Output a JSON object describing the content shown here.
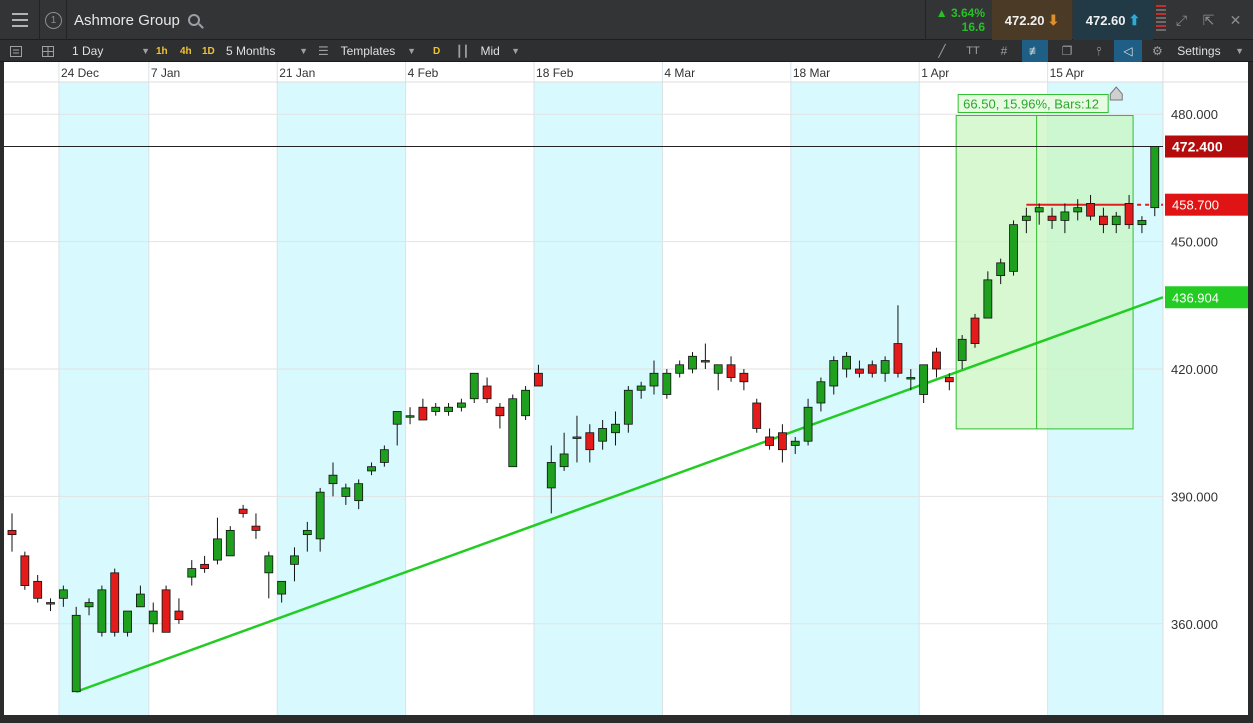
{
  "header": {
    "instrument": "Ashmore Group",
    "version_number": "1",
    "change_pct": "3.64%",
    "change_pts": "16.6",
    "sell_price": "472.20",
    "buy_price": "472.60"
  },
  "toolbar": {
    "timeframe": "1 Day",
    "tf_buttons": [
      "1h",
      "4h",
      "1D"
    ],
    "period": "5 Months",
    "templates": "Templates",
    "d_button": "D",
    "price_type": "Mid",
    "settings": "Settings"
  },
  "colors": {
    "up_candle": "#1ea01e",
    "down_candle": "#e31b1b",
    "trendline": "#22cc22",
    "weekend_band": "#d8fafe",
    "measure_fill": "#c9f5c2",
    "current_price_tag": "#b40c0c",
    "level_tag": "#e01414",
    "trend_tag": "#22cc22"
  },
  "chart_data": {
    "type": "candlestick",
    "title": "",
    "x_tick_labels": [
      "24 Dec",
      "7 Jan",
      "21 Jan",
      "4 Feb",
      "18 Feb",
      "4 Mar",
      "18 Mar",
      "1 Apr",
      "15 Apr"
    ],
    "y_tick_labels": [
      "480.000",
      "450.000",
      "420.000",
      "390.000",
      "360.000"
    ],
    "y_ticks": [
      480,
      450,
      420,
      390,
      360
    ],
    "ylim": [
      347,
      481
    ],
    "grid": true,
    "current_price": {
      "value": 472.4,
      "label": "472.400"
    },
    "horizontal_level": {
      "value": 458.7,
      "label": "458.700"
    },
    "trendline": {
      "label": "436.904",
      "start_value": 344.0,
      "end_value": 436.9
    },
    "measurement": {
      "label": "66.50, 15.96%, Bars:12",
      "from": 405.9,
      "to": 472.4
    },
    "candles": [
      {
        "date": "18 Dec",
        "open": 382.0,
        "high": 386.0,
        "low": 377.0,
        "close": 381.0
      },
      {
        "date": "19 Dec",
        "open": 376.0,
        "high": 377.0,
        "low": 368.0,
        "close": 369.0
      },
      {
        "date": "20 Dec",
        "open": 370.0,
        "high": 371.5,
        "low": 365.0,
        "close": 366.0
      },
      {
        "date": "21 Dec",
        "open": 365.0,
        "high": 366.0,
        "low": 363.0,
        "close": 365.0
      },
      {
        "date": "24 Dec",
        "open": 366.0,
        "high": 369.0,
        "low": 364.0,
        "close": 368.0
      },
      {
        "date": "27 Dec",
        "open": 344.0,
        "high": 364.0,
        "low": 344.0,
        "close": 362.0
      },
      {
        "date": "28 Dec",
        "open": 364.0,
        "high": 366.0,
        "low": 362.0,
        "close": 365.0
      },
      {
        "date": "31 Dec",
        "open": 358.0,
        "high": 369.0,
        "low": 357.0,
        "close": 368.0
      },
      {
        "date": "2 Jan",
        "open": 372.0,
        "high": 373.0,
        "low": 357.0,
        "close": 358.0
      },
      {
        "date": "3 Jan",
        "open": 358.0,
        "high": 363.0,
        "low": 357.0,
        "close": 363.0
      },
      {
        "date": "4 Jan",
        "open": 364.0,
        "high": 369.0,
        "low": 364.0,
        "close": 367.0
      },
      {
        "date": "7 Jan",
        "open": 360.0,
        "high": 365.0,
        "low": 358.0,
        "close": 363.0
      },
      {
        "date": "8 Jan",
        "open": 368.0,
        "high": 369.0,
        "low": 358.0,
        "close": 358.0
      },
      {
        "date": "9 Jan",
        "open": 363.0,
        "high": 366.0,
        "low": 360.0,
        "close": 361.0
      },
      {
        "date": "10 Jan",
        "open": 371.0,
        "high": 375.0,
        "low": 369.0,
        "close": 373.0
      },
      {
        "date": "11 Jan",
        "open": 374.0,
        "high": 376.0,
        "low": 372.0,
        "close": 373.0
      },
      {
        "date": "14 Jan",
        "open": 375.0,
        "high": 385.0,
        "low": 374.0,
        "close": 380.0
      },
      {
        "date": "15 Jan",
        "open": 376.0,
        "high": 383.0,
        "low": 376.0,
        "close": 382.0
      },
      {
        "date": "16 Jan",
        "open": 387.0,
        "high": 388.0,
        "low": 385.0,
        "close": 386.0
      },
      {
        "date": "17 Jan",
        "open": 383.0,
        "high": 386.0,
        "low": 380.0,
        "close": 382.0
      },
      {
        "date": "18 Jan",
        "open": 372.0,
        "high": 377.0,
        "low": 366.0,
        "close": 376.0
      },
      {
        "date": "21 Jan",
        "open": 367.0,
        "high": 370.0,
        "low": 365.0,
        "close": 370.0
      },
      {
        "date": "22 Jan",
        "open": 374.0,
        "high": 378.0,
        "low": 370.0,
        "close": 376.0
      },
      {
        "date": "23 Jan",
        "open": 381.0,
        "high": 384.0,
        "low": 377.0,
        "close": 382.0
      },
      {
        "date": "24 Jan",
        "open": 380.0,
        "high": 392.0,
        "low": 377.0,
        "close": 391.0
      },
      {
        "date": "25 Jan",
        "open": 393.0,
        "high": 398.0,
        "low": 390.0,
        "close": 395.0
      },
      {
        "date": "28 Jan",
        "open": 390.0,
        "high": 393.0,
        "low": 388.0,
        "close": 392.0
      },
      {
        "date": "29 Jan",
        "open": 389.0,
        "high": 394.0,
        "low": 387.0,
        "close": 393.0
      },
      {
        "date": "30 Jan",
        "open": 396.0,
        "high": 398.0,
        "low": 395.0,
        "close": 397.0
      },
      {
        "date": "31 Jan",
        "open": 398.0,
        "high": 402.0,
        "low": 397.0,
        "close": 401.0
      },
      {
        "date": "1 Feb",
        "open": 407.0,
        "high": 410.0,
        "low": 402.0,
        "close": 410.0
      },
      {
        "date": "4 Feb",
        "open": 409.0,
        "high": 411.0,
        "low": 407.0,
        "close": 409.0
      },
      {
        "date": "5 Feb",
        "open": 411.0,
        "high": 413.0,
        "low": 408.0,
        "close": 408.0
      },
      {
        "date": "6 Feb",
        "open": 410.0,
        "high": 412.0,
        "low": 409.0,
        "close": 411.0
      },
      {
        "date": "7 Feb",
        "open": 410.0,
        "high": 412.0,
        "low": 409.0,
        "close": 411.0
      },
      {
        "date": "8 Feb",
        "open": 411.0,
        "high": 413.0,
        "low": 410.0,
        "close": 412.0
      },
      {
        "date": "11 Feb",
        "open": 413.0,
        "high": 419.0,
        "low": 412.0,
        "close": 419.0
      },
      {
        "date": "12 Feb",
        "open": 416.0,
        "high": 418.0,
        "low": 412.0,
        "close": 413.0
      },
      {
        "date": "13 Feb",
        "open": 411.0,
        "high": 412.0,
        "low": 406.0,
        "close": 409.0
      },
      {
        "date": "14 Feb",
        "open": 397.0,
        "high": 414.0,
        "low": 397.0,
        "close": 413.0
      },
      {
        "date": "15 Feb",
        "open": 409.0,
        "high": 416.0,
        "low": 408.0,
        "close": 415.0
      },
      {
        "date": "18 Feb",
        "open": 419.0,
        "high": 421.0,
        "low": 416.0,
        "close": 416.0
      },
      {
        "date": "19 Feb",
        "open": 392.0,
        "high": 402.0,
        "low": 386.0,
        "close": 398.0
      },
      {
        "date": "20 Feb",
        "open": 397.0,
        "high": 405.0,
        "low": 396.0,
        "close": 400.0
      },
      {
        "date": "21 Feb",
        "open": 404.0,
        "high": 409.0,
        "low": 398.0,
        "close": 404.0
      },
      {
        "date": "22 Feb",
        "open": 405.0,
        "high": 407.0,
        "low": 398.0,
        "close": 401.0
      },
      {
        "date": "25 Feb",
        "open": 403.0,
        "high": 408.0,
        "low": 401.0,
        "close": 406.0
      },
      {
        "date": "26 Feb",
        "open": 405.0,
        "high": 410.0,
        "low": 402.0,
        "close": 407.0
      },
      {
        "date": "27 Feb",
        "open": 407.0,
        "high": 416.0,
        "low": 405.0,
        "close": 415.0
      },
      {
        "date": "28 Feb",
        "open": 415.0,
        "high": 417.0,
        "low": 413.0,
        "close": 416.0
      },
      {
        "date": "1 Mar",
        "open": 416.0,
        "high": 422.0,
        "low": 414.0,
        "close": 419.0
      },
      {
        "date": "4 Mar",
        "open": 414.0,
        "high": 420.0,
        "low": 413.0,
        "close": 419.0
      },
      {
        "date": "5 Mar",
        "open": 419.0,
        "high": 422.0,
        "low": 418.0,
        "close": 421.0
      },
      {
        "date": "6 Mar",
        "open": 420.0,
        "high": 424.0,
        "low": 419.0,
        "close": 423.0
      },
      {
        "date": "7 Mar",
        "open": 422.0,
        "high": 426.0,
        "low": 420.0,
        "close": 422.0
      },
      {
        "date": "8 Mar",
        "open": 419.0,
        "high": 421.0,
        "low": 415.0,
        "close": 421.0
      },
      {
        "date": "11 Mar",
        "open": 421.0,
        "high": 423.0,
        "low": 417.0,
        "close": 418.0
      },
      {
        "date": "12 Mar",
        "open": 419.0,
        "high": 420.0,
        "low": 415.0,
        "close": 417.0
      },
      {
        "date": "13 Mar",
        "open": 412.0,
        "high": 413.0,
        "low": 405.0,
        "close": 406.0
      },
      {
        "date": "14 Mar",
        "open": 404.0,
        "high": 406.0,
        "low": 401.0,
        "close": 402.0
      },
      {
        "date": "15 Mar",
        "open": 405.0,
        "high": 407.0,
        "low": 398.0,
        "close": 401.0
      },
      {
        "date": "18 Mar",
        "open": 402.0,
        "high": 404.0,
        "low": 400.0,
        "close": 403.0
      },
      {
        "date": "19 Mar",
        "open": 403.0,
        "high": 413.0,
        "low": 402.0,
        "close": 411.0
      },
      {
        "date": "20 Mar",
        "open": 412.0,
        "high": 418.0,
        "low": 410.0,
        "close": 417.0
      },
      {
        "date": "21 Mar",
        "open": 416.0,
        "high": 423.0,
        "low": 414.0,
        "close": 422.0
      },
      {
        "date": "22 Mar",
        "open": 420.0,
        "high": 424.0,
        "low": 418.0,
        "close": 423.0
      },
      {
        "date": "25 Mar",
        "open": 420.0,
        "high": 422.0,
        "low": 418.0,
        "close": 419.0
      },
      {
        "date": "26 Mar",
        "open": 421.0,
        "high": 422.0,
        "low": 418.0,
        "close": 419.0
      },
      {
        "date": "27 Mar",
        "open": 419.0,
        "high": 423.0,
        "low": 417.0,
        "close": 422.0
      },
      {
        "date": "28 Mar",
        "open": 426.0,
        "high": 435.0,
        "low": 418.0,
        "close": 419.0
      },
      {
        "date": "29 Mar",
        "open": 418.0,
        "high": 420.0,
        "low": 415.0,
        "close": 418.0
      },
      {
        "date": "1 Apr",
        "open": 414.0,
        "high": 421.0,
        "low": 412.0,
        "close": 421.0
      },
      {
        "date": "2 Apr",
        "open": 424.0,
        "high": 425.0,
        "low": 418.0,
        "close": 420.0
      },
      {
        "date": "3 Apr",
        "open": 418.0,
        "high": 419.0,
        "low": 415.0,
        "close": 417.0
      },
      {
        "date": "4 Apr",
        "open": 422.0,
        "high": 428.0,
        "low": 420.0,
        "close": 427.0
      },
      {
        "date": "5 Apr",
        "open": 432.0,
        "high": 433.0,
        "low": 425.0,
        "close": 426.0
      },
      {
        "date": "8 Apr",
        "open": 432.0,
        "high": 443.0,
        "low": 432.0,
        "close": 441.0
      },
      {
        "date": "9 Apr",
        "open": 442.0,
        "high": 446.0,
        "low": 440.0,
        "close": 445.0
      },
      {
        "date": "10 Apr",
        "open": 443.0,
        "high": 455.0,
        "low": 442.0,
        "close": 454.0
      },
      {
        "date": "11 Apr",
        "open": 455.0,
        "high": 458.0,
        "low": 452.0,
        "close": 456.0
      },
      {
        "date": "12 Apr",
        "open": 457.0,
        "high": 459.0,
        "low": 454.0,
        "close": 458.0
      },
      {
        "date": "15 Apr",
        "open": 456.0,
        "high": 458.0,
        "low": 453.0,
        "close": 455.0
      },
      {
        "date": "16 Apr",
        "open": 455.0,
        "high": 459.0,
        "low": 452.0,
        "close": 457.0
      },
      {
        "date": "17 Apr",
        "open": 457.0,
        "high": 460.0,
        "low": 455.0,
        "close": 458.0
      },
      {
        "date": "18 Apr",
        "open": 459.0,
        "high": 461.0,
        "low": 455.0,
        "close": 456.0
      },
      {
        "date": "19 Apr",
        "open": 456.0,
        "high": 458.0,
        "low": 452.0,
        "close": 454.0
      },
      {
        "date": "22 Apr",
        "open": 454.0,
        "high": 457.0,
        "low": 452.0,
        "close": 456.0
      },
      {
        "date": "23 Apr",
        "open": 459.0,
        "high": 461.0,
        "low": 453.0,
        "close": 454.0
      },
      {
        "date": "24 Apr",
        "open": 454.0,
        "high": 456.0,
        "low": 452.0,
        "close": 455.0
      },
      {
        "date": "25 Apr",
        "open": 458.0,
        "high": 472.4,
        "low": 456.0,
        "close": 472.4
      }
    ]
  }
}
